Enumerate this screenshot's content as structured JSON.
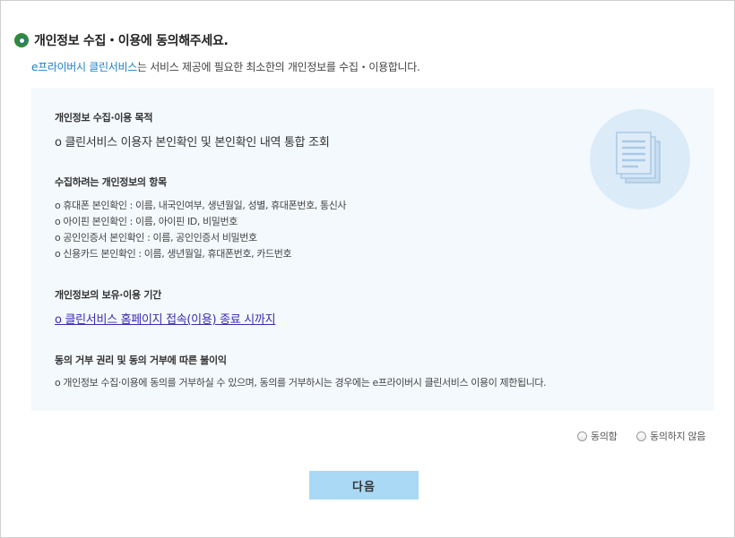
{
  "header": {
    "title": "개인정보 수집・이용에 동의해주세요.",
    "intro_brand": "e프라이버시 클린서비스",
    "intro_rest": "는 서비스 제공에 필요한 최소한의 개인정보를 수집・이용합니다."
  },
  "sections": {
    "purpose": {
      "title": "개인정보 수집·이용 목적",
      "item": "o 클린서비스 이용자 본인확인 및 본인확인 내역 통합 조회"
    },
    "items": {
      "title": "수집하려는 개인정보의 항목",
      "list": [
        "o 휴대폰 본인확인 : 이름, 내국인여부, 생년월일, 성별, 휴대폰번호, 통신사",
        "o 아이핀 본인확인 : 이름, 아이핀 ID, 비밀번호",
        "o 공인인증서 본인확인 : 이름, 공인인증서 비밀번호",
        "o 신용카드 본인확인 : 이름, 생년월일, 휴대폰번호, 카드번호"
      ]
    },
    "retention": {
      "title": "개인정보의 보유·이용 기간",
      "item": "o 클린서비스 홈페이지 접속(이용) 종료 시까지"
    },
    "refusal": {
      "title": "동의 거부 권리 및 동의 거부에 따른 불이익",
      "item": "o 개인정보 수집·이용에 동의를 거부하실 수 있으며, 동의를 거부하시는 경우에는 e프라이버시 클린서비스 이용이 제한됩니다."
    }
  },
  "consent": {
    "agree_label": "동의함",
    "disagree_label": "동의하지 않음"
  },
  "next_button": "다음",
  "icons": {
    "title": "radio-bullet-icon",
    "panel": "document-stack-icon"
  },
  "colors": {
    "brand": "#1e7fc4",
    "panel_bg": "#f4f9fd",
    "button_bg": "#a9d9f5",
    "link": "#3b2bb0"
  }
}
